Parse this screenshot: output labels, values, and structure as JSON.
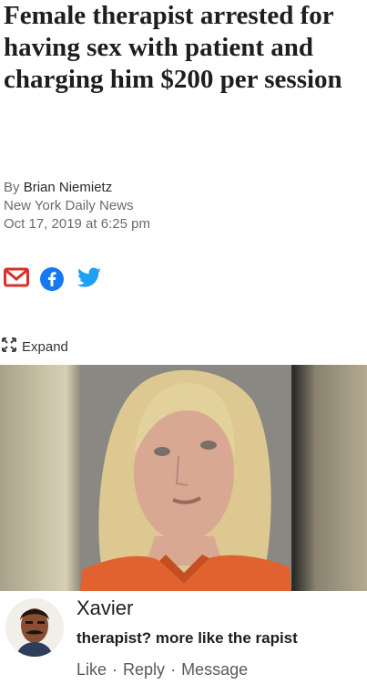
{
  "article": {
    "headline": "Female therapist arrested for having sex with patient and charging him $200 per session",
    "byline_prefix": "By",
    "author": "Brian Niemietz",
    "publication": "New York Daily News",
    "date": "Oct 17, 2019 at 6:25 pm",
    "expand_label": "Expand"
  },
  "share": {
    "icons": [
      "email-icon",
      "facebook-icon",
      "twitter-icon"
    ],
    "colors": {
      "email": "#d9302c",
      "facebook": "#1877f2",
      "twitter": "#1da1f2"
    }
  },
  "comment": {
    "name": "Xavier",
    "text": "therapist? more like the rapist",
    "actions": {
      "like": "Like",
      "reply": "Reply",
      "message": "Message",
      "separator": "·"
    }
  }
}
